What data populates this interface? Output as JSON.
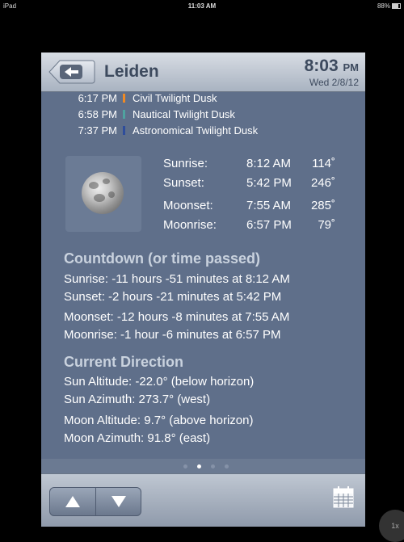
{
  "status_bar": {
    "device": "iPad",
    "time": "11:03 AM",
    "battery": "88%"
  },
  "nav": {
    "back_label": "back",
    "city": "Leiden",
    "time": "8:03",
    "ampm": "PM",
    "date": "Wed 2/8/12"
  },
  "twilight": [
    {
      "time": "6:17 PM",
      "label": "Civil Twilight Dusk",
      "color": "#f08a24"
    },
    {
      "time": "6:58 PM",
      "label": "Nautical Twilight Dusk",
      "color": "#4fa3a0"
    },
    {
      "time": "7:37 PM",
      "label": "Astronomical Twilight Dusk",
      "color": "#2e4d9b"
    }
  ],
  "rise_set": [
    {
      "label": "Sunrise:",
      "time": "8:12 AM",
      "azimuth": "114˚"
    },
    {
      "label": "Sunset:",
      "time": "5:42 PM",
      "azimuth": "246˚"
    },
    {
      "label": "Moonset:",
      "time": "7:55 AM",
      "azimuth": "285˚"
    },
    {
      "label": "Moonrise:",
      "time": "6:57 PM",
      "azimuth": "79˚"
    }
  ],
  "countdown": {
    "title": "Countdown (or time passed)",
    "lines": [
      "Sunrise: -11 hours -51 minutes at 8:12 AM",
      "Sunset: -2 hours -21 minutes at 5:42 PM",
      "Moonset: -12 hours -8 minutes at 7:55 AM",
      "Moonrise: -1 hour -6 minutes at 6:57 PM"
    ]
  },
  "direction": {
    "title": "Current Direction",
    "lines": [
      "Sun Altitude: -22.0°  (below horizon)",
      "Sun Azimuth: 273.7°  (west)",
      "Moon Altitude: 9.7°  (above horizon)",
      "Moon Azimuth: 91.8°  (east)"
    ]
  },
  "pager": {
    "pages": 4,
    "active": 2
  },
  "toolbar": {
    "prev_icon": "up-arrow-icon",
    "next_icon": "down-arrow-icon",
    "calendar_icon": "calendar-icon"
  },
  "zoom_badge": "1x"
}
